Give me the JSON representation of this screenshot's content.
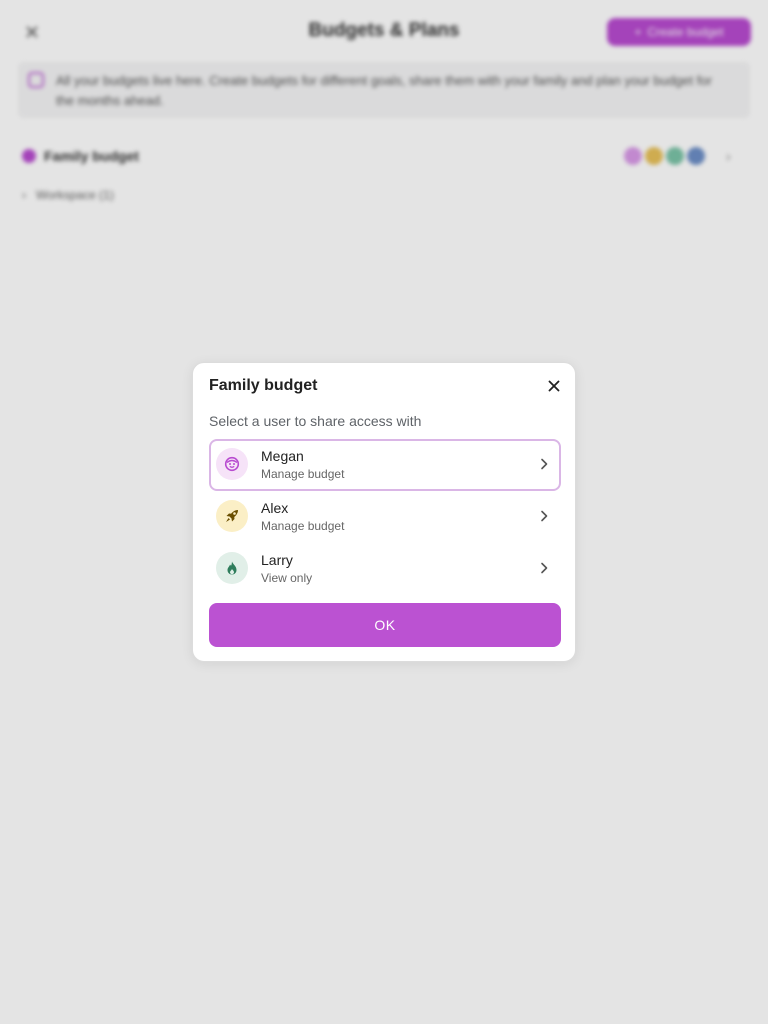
{
  "background": {
    "title": "Budgets & Plans",
    "create_label": "Create budget",
    "banner_text": "All your budgets live here. Create budgets for different goals, share them with your family and plan your budget for the months ahead.",
    "budget_name": "Family budget",
    "workspace_label": "Workspace (1)",
    "colors": {
      "accent": "#b84bd0",
      "avatars": [
        "#d99ae8",
        "#e8c15a",
        "#7cc4a8",
        "#6d8fc7"
      ]
    }
  },
  "dialog": {
    "title": "Family budget",
    "subtitle": "Select a user to share access with",
    "users": [
      {
        "name": "Megan",
        "role": "Manage budget",
        "icon": "smiley-face-icon",
        "avatar_bg": "#f6e3f8",
        "icon_color": "#b84bd0",
        "selected": true
      },
      {
        "name": "Alex",
        "role": "Manage budget",
        "icon": "rocket-icon",
        "avatar_bg": "#fbefc6",
        "icon_color": "#7a5a00",
        "selected": false
      },
      {
        "name": "Larry",
        "role": "View only",
        "icon": "flame-icon",
        "avatar_bg": "#e1efe8",
        "icon_color": "#2f7d5c",
        "selected": false
      }
    ],
    "ok_label": "OK",
    "colors": {
      "button": "#bb52d2",
      "selected_border": "#dab6e6"
    }
  }
}
